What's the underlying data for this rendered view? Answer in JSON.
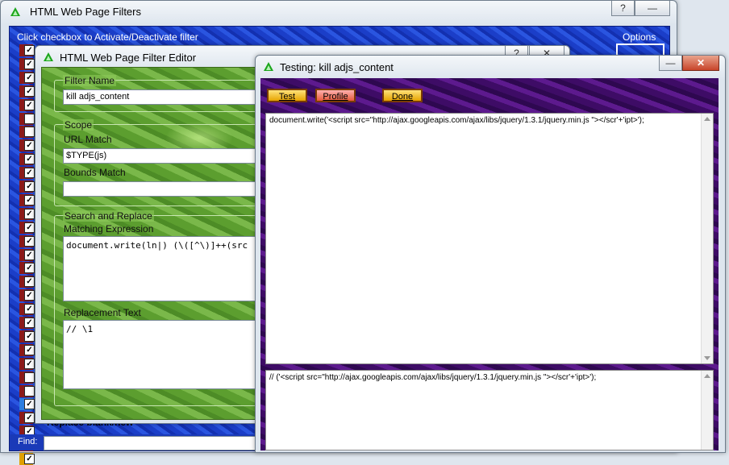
{
  "main_window": {
    "title": "HTML Web Page Filters",
    "help_label": "?",
    "minimize_label": "—",
    "hint": "Click checkbox to Activate/Deactivate filter",
    "options_label": "Options",
    "partial_row_label": "Replace blank/new",
    "find_label": "Find:",
    "rows": [
      {
        "checked": true,
        "style": "red"
      },
      {
        "checked": true,
        "style": "red"
      },
      {
        "checked": true,
        "style": "red"
      },
      {
        "checked": true,
        "style": "red"
      },
      {
        "checked": true,
        "style": "red"
      },
      {
        "checked": false,
        "style": "red"
      },
      {
        "checked": false,
        "style": "red"
      },
      {
        "checked": true,
        "style": "red"
      },
      {
        "checked": true,
        "style": "red"
      },
      {
        "checked": true,
        "style": "red"
      },
      {
        "checked": true,
        "style": "red"
      },
      {
        "checked": true,
        "style": "red"
      },
      {
        "checked": true,
        "style": "red"
      },
      {
        "checked": true,
        "style": "red"
      },
      {
        "checked": true,
        "style": "red"
      },
      {
        "checked": true,
        "style": "red"
      },
      {
        "checked": true,
        "style": "red"
      },
      {
        "checked": true,
        "style": "red"
      },
      {
        "checked": true,
        "style": "red"
      },
      {
        "checked": true,
        "style": "red"
      },
      {
        "checked": true,
        "style": "red"
      },
      {
        "checked": true,
        "style": "red"
      },
      {
        "checked": true,
        "style": "red"
      },
      {
        "checked": true,
        "style": "red"
      },
      {
        "checked": false,
        "style": "red"
      },
      {
        "checked": false,
        "style": "red"
      },
      {
        "checked": true,
        "style": "blue"
      },
      {
        "checked": true,
        "style": "red"
      },
      {
        "checked": true,
        "style": "red"
      },
      {
        "checked": true,
        "style": "red"
      },
      {
        "checked": true,
        "style": "yellow"
      }
    ]
  },
  "editor_window": {
    "title": "HTML Web Page Filter Editor",
    "help_label": "?",
    "close_label": "✕",
    "filter_name_group": "Filter Name",
    "filter_name_value": "kill adjs_content",
    "scope_group": "Scope",
    "url_match_label": "URL Match",
    "url_match_value": "$TYPE(js)",
    "bounds_match_label": "Bounds Match",
    "bounds_match_value": "",
    "search_replace_group": "Search and Replace",
    "matching_expression_label": "Matching Expression",
    "matching_expression_value": "document.write(ln|) (\\([^\\)]++(src",
    "replacement_text_label": "Replacement Text",
    "replacement_text_value": "// \\1"
  },
  "testing_window": {
    "title": "Testing: kill adjs_content",
    "minimize_label": "—",
    "close_label": "✕",
    "test_button": "Test",
    "profile_button": "Profile",
    "done_button": "Done",
    "input_text": "document.write('<script src=\"http://ajax.googleapis.com/ajax/libs/jquery/1.3.1/jquery.min.js \"></scr'+'ipt>');",
    "output_text": "// ('<script src=\"http://ajax.googleapis.com/ajax/libs/jquery/1.3.1/jquery.min.js \"></scr'+'ipt>');"
  },
  "colors": {
    "checkbox_cell_red": "#8b1a1a",
    "checkbox_cell_blue": "#2b7de0",
    "checkbox_cell_yellow": "#e0a000",
    "button_gold": "#e6a400",
    "titlebar_icon_green": "#1aa51a"
  }
}
